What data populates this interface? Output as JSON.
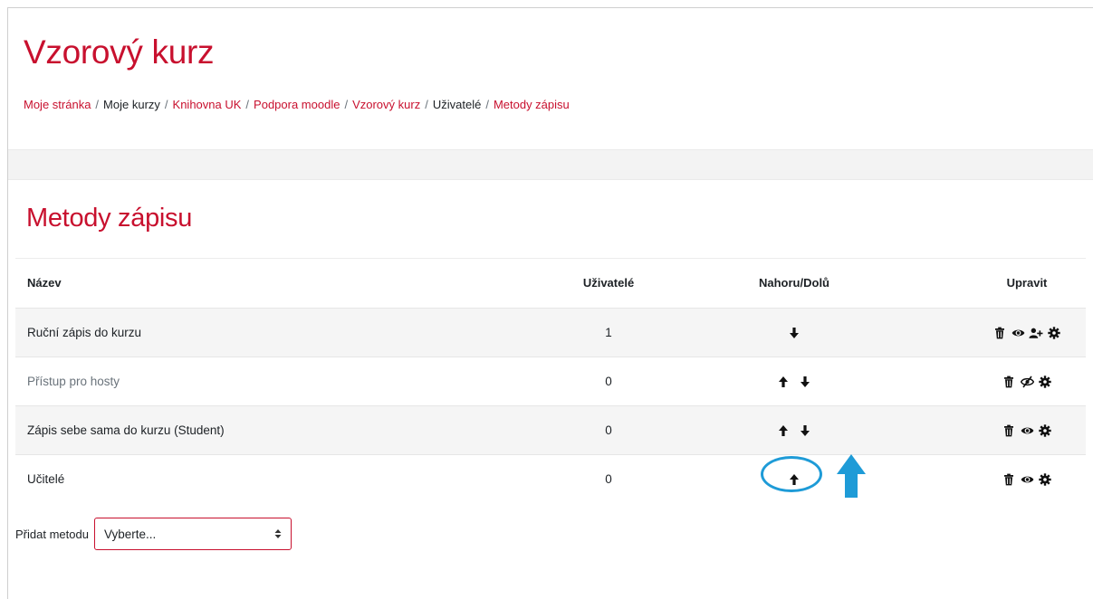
{
  "course": {
    "title": "Vzorový kurz"
  },
  "breadcrumb": [
    {
      "label": "Moje stránka",
      "link": true
    },
    {
      "label": "Moje kurzy",
      "link": false
    },
    {
      "label": "Knihovna UK",
      "link": true
    },
    {
      "label": "Podpora moodle",
      "link": true
    },
    {
      "label": "Vzorový kurz",
      "link": true
    },
    {
      "label": "Uživatelé",
      "link": false
    },
    {
      "label": "Metody zápisu",
      "link": true
    }
  ],
  "breadcrumb_separator": "/",
  "section": {
    "title": "Metody zápisu"
  },
  "table": {
    "headers": {
      "name": "Název",
      "users": "Uživatelé",
      "updown": "Nahoru/Dolů",
      "edit": "Upravit"
    },
    "rows": [
      {
        "name": "Ruční zápis do kurzu",
        "users": "1",
        "updown": [
          "arrow-down-icon"
        ],
        "edit": [
          "trash-icon",
          "eye-icon",
          "enrol-users-icon",
          "gear-icon"
        ],
        "disabled": false
      },
      {
        "name": "Přístup pro hosty",
        "users": "0",
        "updown": [
          "arrow-up-icon",
          "arrow-down-icon"
        ],
        "edit": [
          "trash-icon",
          "eye-slash-icon",
          "gear-icon"
        ],
        "disabled": true
      },
      {
        "name": "Zápis sebe sama do kurzu (Student)",
        "users": "0",
        "updown": [
          "arrow-up-icon",
          "arrow-down-icon"
        ],
        "edit": [
          "trash-icon",
          "eye-icon",
          "gear-icon"
        ],
        "disabled": false
      },
      {
        "name": "Učitelé",
        "users": "0",
        "updown": [
          "arrow-up-icon"
        ],
        "edit": [
          "trash-icon",
          "eye-icon",
          "gear-icon"
        ],
        "disabled": false
      }
    ]
  },
  "add_method": {
    "label": "Přidat metodu",
    "select_value": "Vyberte..."
  },
  "annotation": {
    "color": "#1e9bd7"
  },
  "colors": {
    "accent": "#c8102e",
    "text": "#1d2125",
    "muted": "#6a737b",
    "band": "#f3f3f3"
  }
}
